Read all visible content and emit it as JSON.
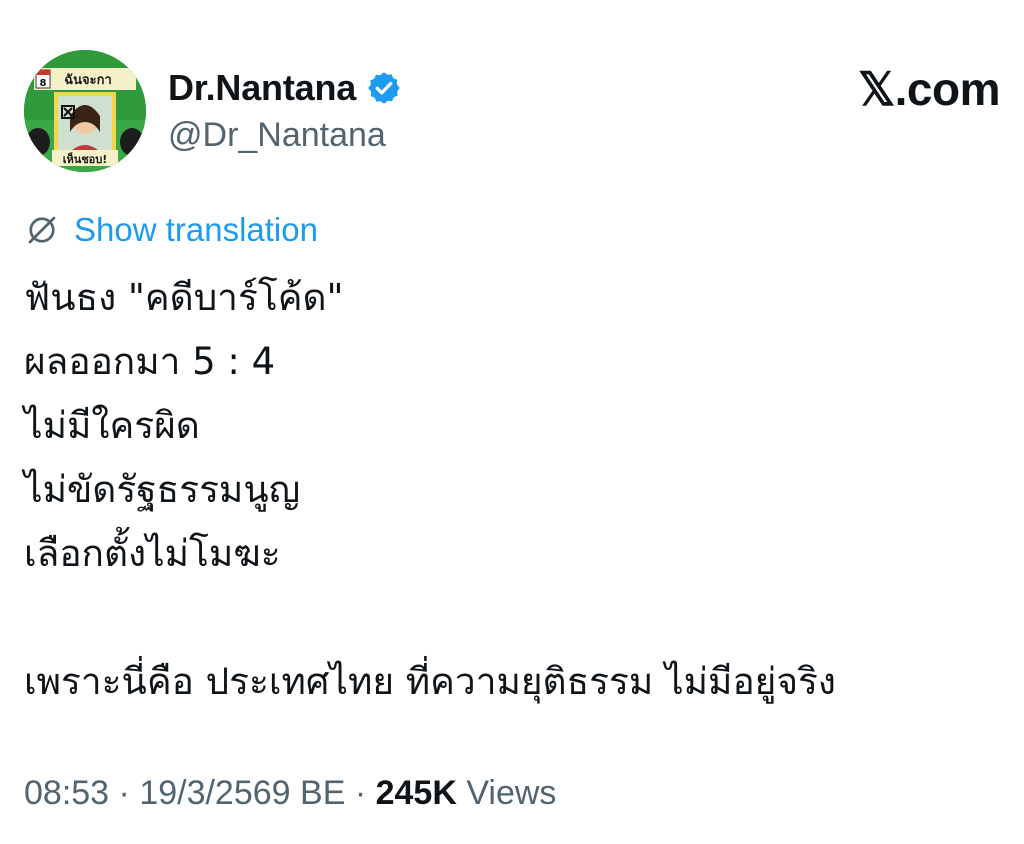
{
  "author": {
    "display_name": "Dr.Nantana",
    "handle": "@Dr_Nantana",
    "verified": true,
    "avatar": {
      "banner_top": "ฉันจะกา",
      "banner_bottom": "เห็นชอบ!",
      "calendar_number": "8"
    }
  },
  "brand": "𝕏.com",
  "translate": {
    "icon": "translate-icon",
    "label": "Show translation"
  },
  "tweet": {
    "lines": [
      "ฟันธง \"คดีบาร์โค้ด\"",
      "ผลออกมา 5 : 4",
      "ไม่มีใครผิด",
      "ไม่ขัดรัฐธรรมนูญ",
      "เลือกตั้งไม่โมฆะ",
      "",
      "เพราะนี่คือ ประเทศไทย ที่ความยุติธรรม ไม่มีอยู่จริง"
    ]
  },
  "meta": {
    "time": "08:53",
    "separator": " · ",
    "date": "19/3/2569 BE",
    "views_count": "245K",
    "views_label": " Views"
  },
  "colors": {
    "accent": "#1d9bf0",
    "secondary_text": "#536471",
    "primary_text": "#0f1419",
    "avatar_green": "#2f9a3c"
  }
}
